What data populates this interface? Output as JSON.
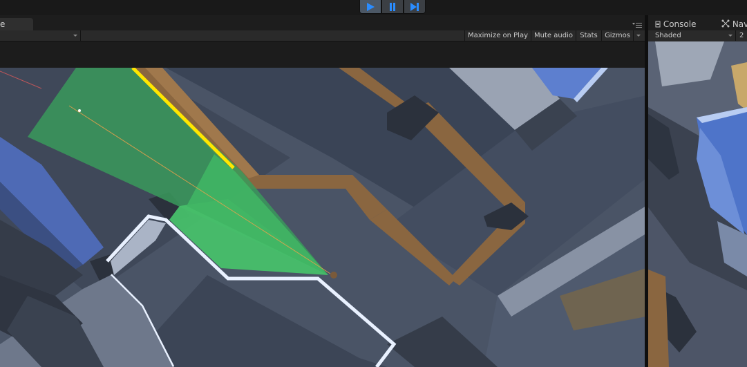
{
  "game_panel": {
    "tab_label": "e",
    "toolbar": {
      "maximize_label": "Maximize on Play",
      "mute_label": "Mute audio",
      "stats_label": "Stats",
      "gizmos_label": "Gizmos"
    }
  },
  "scene_panel": {
    "tabs": [
      {
        "label": "Console",
        "icon": "console-icon"
      },
      {
        "label": "Navi",
        "icon": "navigation-icon"
      }
    ],
    "draw_mode": "Shaded",
    "mode_2d": "2"
  },
  "play_controls": {
    "buttons": [
      "play",
      "pause",
      "step"
    ],
    "play_active": true
  },
  "colors": {
    "accent_blue": "#2a8cff",
    "vision_cone_green": "#3fbf68",
    "wall_brown": "#8a6640",
    "floor_slate": "#4c5668",
    "highlight_yellow": "#ffe600",
    "selection_red": "#e01a1a"
  }
}
